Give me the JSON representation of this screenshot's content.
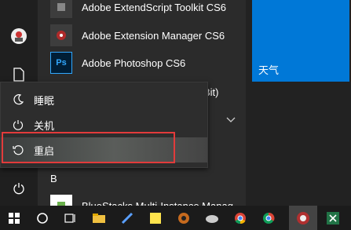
{
  "apps": [
    {
      "label": "Adobe ExtendScript Toolkit CS6",
      "icon": "extendscript-icon"
    },
    {
      "label": "Adobe Extension Manager CS6",
      "icon": "extension-manager-icon"
    },
    {
      "label": "Adobe Photoshop CS6",
      "icon": "photoshop-icon",
      "tile_text": "Ps"
    }
  ],
  "partial_text": "Bit)",
  "section_letter": "B",
  "bluestacks_label": "BlueStacks Multi-Instance Manag",
  "tiles": {
    "weather_label": "天气"
  },
  "power_menu": {
    "sleep": "睡眠",
    "shutdown": "关机",
    "restart": "重启"
  },
  "colors": {
    "accent": "#0078d7",
    "highlight_border": "#e23b3b"
  }
}
